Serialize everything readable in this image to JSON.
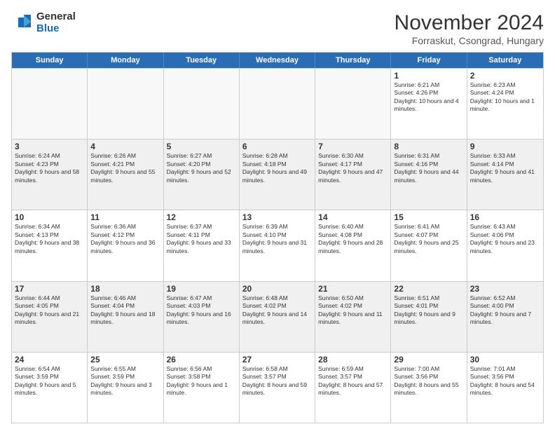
{
  "logo": {
    "general": "General",
    "blue": "Blue"
  },
  "title": "November 2024",
  "location": "Forraskut, Csongrad, Hungary",
  "header_days": [
    "Sunday",
    "Monday",
    "Tuesday",
    "Wednesday",
    "Thursday",
    "Friday",
    "Saturday"
  ],
  "weeks": [
    [
      {
        "day": "",
        "empty": true
      },
      {
        "day": "",
        "empty": true
      },
      {
        "day": "",
        "empty": true
      },
      {
        "day": "",
        "empty": true
      },
      {
        "day": "",
        "empty": true
      },
      {
        "day": "1",
        "sunrise": "Sunrise: 6:21 AM",
        "sunset": "Sunset: 4:26 PM",
        "daylight": "Daylight: 10 hours and 4 minutes."
      },
      {
        "day": "2",
        "sunrise": "Sunrise: 6:23 AM",
        "sunset": "Sunset: 4:24 PM",
        "daylight": "Daylight: 10 hours and 1 minute."
      }
    ],
    [
      {
        "day": "3",
        "sunrise": "Sunrise: 6:24 AM",
        "sunset": "Sunset: 4:23 PM",
        "daylight": "Daylight: 9 hours and 58 minutes."
      },
      {
        "day": "4",
        "sunrise": "Sunrise: 6:26 AM",
        "sunset": "Sunset: 4:21 PM",
        "daylight": "Daylight: 9 hours and 55 minutes."
      },
      {
        "day": "5",
        "sunrise": "Sunrise: 6:27 AM",
        "sunset": "Sunset: 4:20 PM",
        "daylight": "Daylight: 9 hours and 52 minutes."
      },
      {
        "day": "6",
        "sunrise": "Sunrise: 6:28 AM",
        "sunset": "Sunset: 4:18 PM",
        "daylight": "Daylight: 9 hours and 49 minutes."
      },
      {
        "day": "7",
        "sunrise": "Sunrise: 6:30 AM",
        "sunset": "Sunset: 4:17 PM",
        "daylight": "Daylight: 9 hours and 47 minutes."
      },
      {
        "day": "8",
        "sunrise": "Sunrise: 6:31 AM",
        "sunset": "Sunset: 4:16 PM",
        "daylight": "Daylight: 9 hours and 44 minutes."
      },
      {
        "day": "9",
        "sunrise": "Sunrise: 6:33 AM",
        "sunset": "Sunset: 4:14 PM",
        "daylight": "Daylight: 9 hours and 41 minutes."
      }
    ],
    [
      {
        "day": "10",
        "sunrise": "Sunrise: 6:34 AM",
        "sunset": "Sunset: 4:13 PM",
        "daylight": "Daylight: 9 hours and 38 minutes."
      },
      {
        "day": "11",
        "sunrise": "Sunrise: 6:36 AM",
        "sunset": "Sunset: 4:12 PM",
        "daylight": "Daylight: 9 hours and 36 minutes."
      },
      {
        "day": "12",
        "sunrise": "Sunrise: 6:37 AM",
        "sunset": "Sunset: 4:11 PM",
        "daylight": "Daylight: 9 hours and 33 minutes."
      },
      {
        "day": "13",
        "sunrise": "Sunrise: 6:39 AM",
        "sunset": "Sunset: 4:10 PM",
        "daylight": "Daylight: 9 hours and 31 minutes."
      },
      {
        "day": "14",
        "sunrise": "Sunrise: 6:40 AM",
        "sunset": "Sunset: 4:08 PM",
        "daylight": "Daylight: 9 hours and 28 minutes."
      },
      {
        "day": "15",
        "sunrise": "Sunrise: 6:41 AM",
        "sunset": "Sunset: 4:07 PM",
        "daylight": "Daylight: 9 hours and 25 minutes."
      },
      {
        "day": "16",
        "sunrise": "Sunrise: 6:43 AM",
        "sunset": "Sunset: 4:06 PM",
        "daylight": "Daylight: 9 hours and 23 minutes."
      }
    ],
    [
      {
        "day": "17",
        "sunrise": "Sunrise: 6:44 AM",
        "sunset": "Sunset: 4:05 PM",
        "daylight": "Daylight: 9 hours and 21 minutes."
      },
      {
        "day": "18",
        "sunrise": "Sunrise: 6:46 AM",
        "sunset": "Sunset: 4:04 PM",
        "daylight": "Daylight: 9 hours and 18 minutes."
      },
      {
        "day": "19",
        "sunrise": "Sunrise: 6:47 AM",
        "sunset": "Sunset: 4:03 PM",
        "daylight": "Daylight: 9 hours and 16 minutes."
      },
      {
        "day": "20",
        "sunrise": "Sunrise: 6:48 AM",
        "sunset": "Sunset: 4:02 PM",
        "daylight": "Daylight: 9 hours and 14 minutes."
      },
      {
        "day": "21",
        "sunrise": "Sunrise: 6:50 AM",
        "sunset": "Sunset: 4:02 PM",
        "daylight": "Daylight: 9 hours and 11 minutes."
      },
      {
        "day": "22",
        "sunrise": "Sunrise: 6:51 AM",
        "sunset": "Sunset: 4:01 PM",
        "daylight": "Daylight: 9 hours and 9 minutes."
      },
      {
        "day": "23",
        "sunrise": "Sunrise: 6:52 AM",
        "sunset": "Sunset: 4:00 PM",
        "daylight": "Daylight: 9 hours and 7 minutes."
      }
    ],
    [
      {
        "day": "24",
        "sunrise": "Sunrise: 6:54 AM",
        "sunset": "Sunset: 3:59 PM",
        "daylight": "Daylight: 9 hours and 5 minutes."
      },
      {
        "day": "25",
        "sunrise": "Sunrise: 6:55 AM",
        "sunset": "Sunset: 3:59 PM",
        "daylight": "Daylight: 9 hours and 3 minutes."
      },
      {
        "day": "26",
        "sunrise": "Sunrise: 6:56 AM",
        "sunset": "Sunset: 3:58 PM",
        "daylight": "Daylight: 9 hours and 1 minute."
      },
      {
        "day": "27",
        "sunrise": "Sunrise: 6:58 AM",
        "sunset": "Sunset: 3:57 PM",
        "daylight": "Daylight: 8 hours and 59 minutes."
      },
      {
        "day": "28",
        "sunrise": "Sunrise: 6:59 AM",
        "sunset": "Sunset: 3:57 PM",
        "daylight": "Daylight: 8 hours and 57 minutes."
      },
      {
        "day": "29",
        "sunrise": "Sunrise: 7:00 AM",
        "sunset": "Sunset: 3:56 PM",
        "daylight": "Daylight: 8 hours and 55 minutes."
      },
      {
        "day": "30",
        "sunrise": "Sunrise: 7:01 AM",
        "sunset": "Sunset: 3:56 PM",
        "daylight": "Daylight: 8 hours and 54 minutes."
      }
    ]
  ]
}
